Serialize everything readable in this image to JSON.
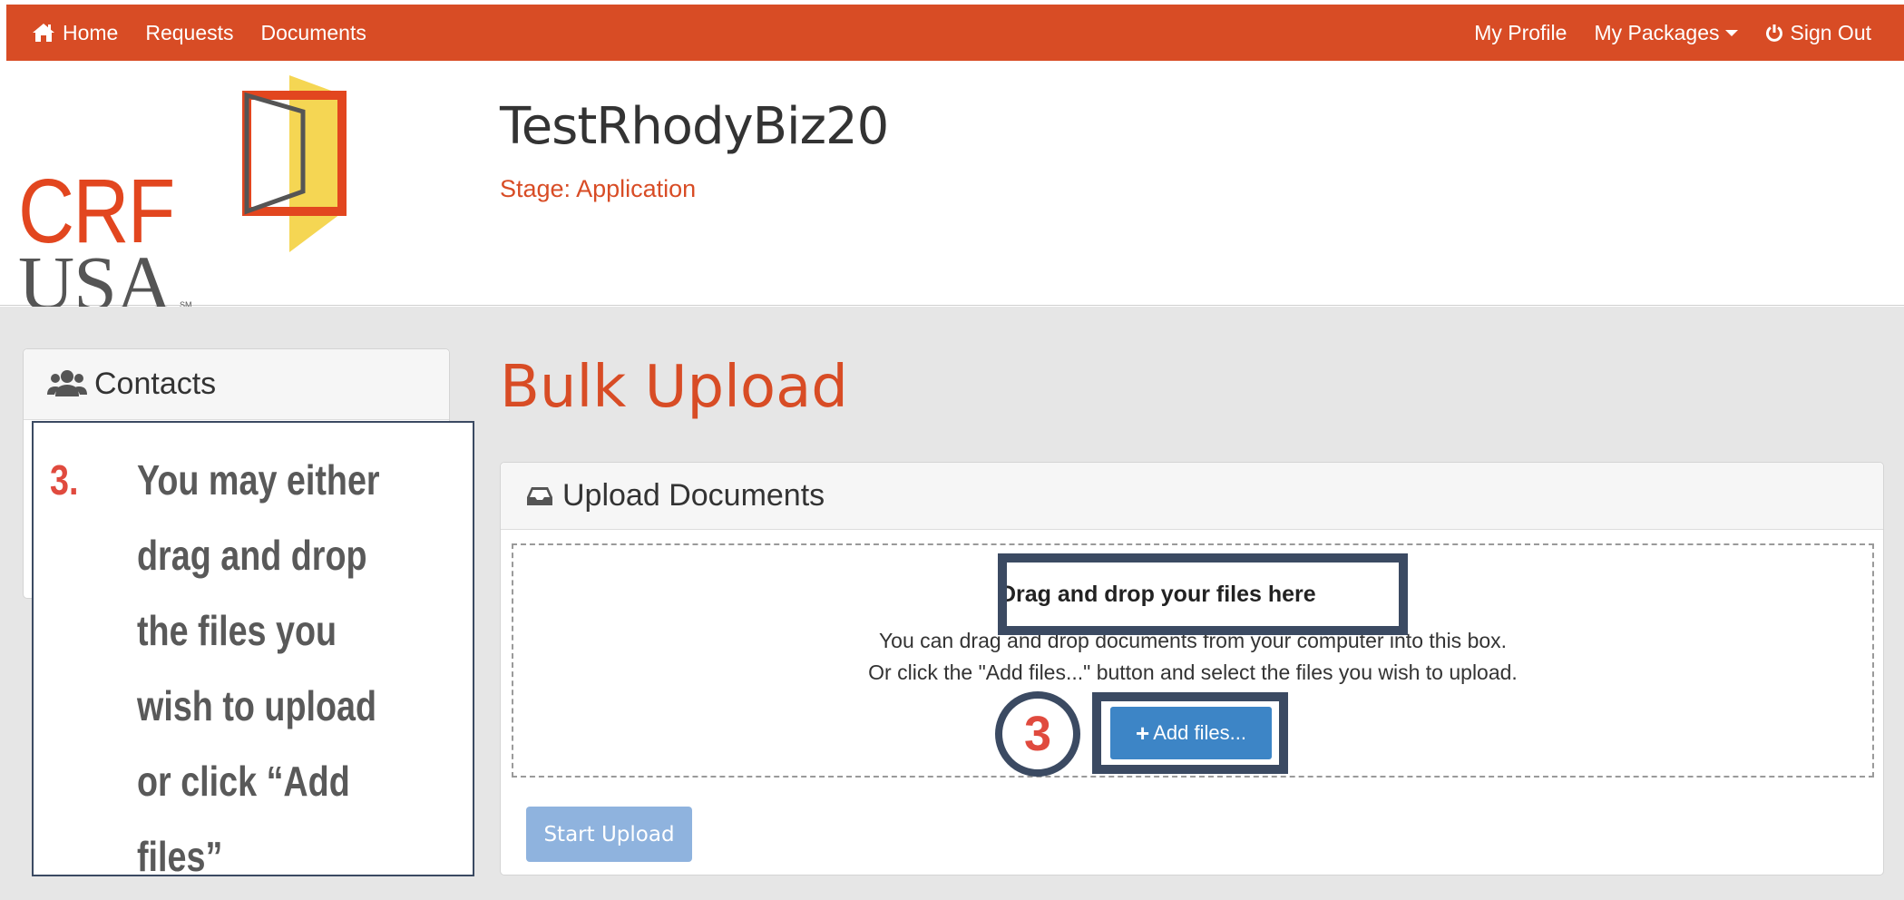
{
  "nav": {
    "home": "Home",
    "requests": "Requests",
    "documents": "Documents",
    "my_profile": "My Profile",
    "my_packages": "My Packages",
    "sign_out": "Sign Out"
  },
  "logo": {
    "line1": "CRF",
    "line2": "USA",
    "mark": "SM"
  },
  "org": {
    "name": "TestRhodyBiz20",
    "stage": "Stage: Application"
  },
  "sidebar": {
    "contacts_title": "Contacts"
  },
  "callout": {
    "number": "3.",
    "text": "You may either drag and drop the files you wish to upload or click “Add files”"
  },
  "page": {
    "title": "Bulk Upload"
  },
  "upload": {
    "panel_title": "Upload Documents",
    "drop_title": "Drag and drop your files here",
    "drop_line1": "You can drag and drop documents from your computer into this box.",
    "drop_line2": "Or click the \"Add files...\" button and select the files you wish to upload.",
    "add_files_label": "Add files...",
    "start_upload_label": "Start Upload",
    "step_marker": "3"
  },
  "colors": {
    "brand_orange": "#d84c25",
    "callout_border": "#3b4a62",
    "callout_number": "#e04a3e",
    "primary_button": "#3d85c6",
    "disabled_button": "#8fb3de"
  },
  "icons": {
    "home": "home-icon",
    "caret": "caret-down-icon",
    "power": "power-icon",
    "users": "users-icon",
    "inbox": "inbox-icon",
    "plus": "plus-icon"
  }
}
